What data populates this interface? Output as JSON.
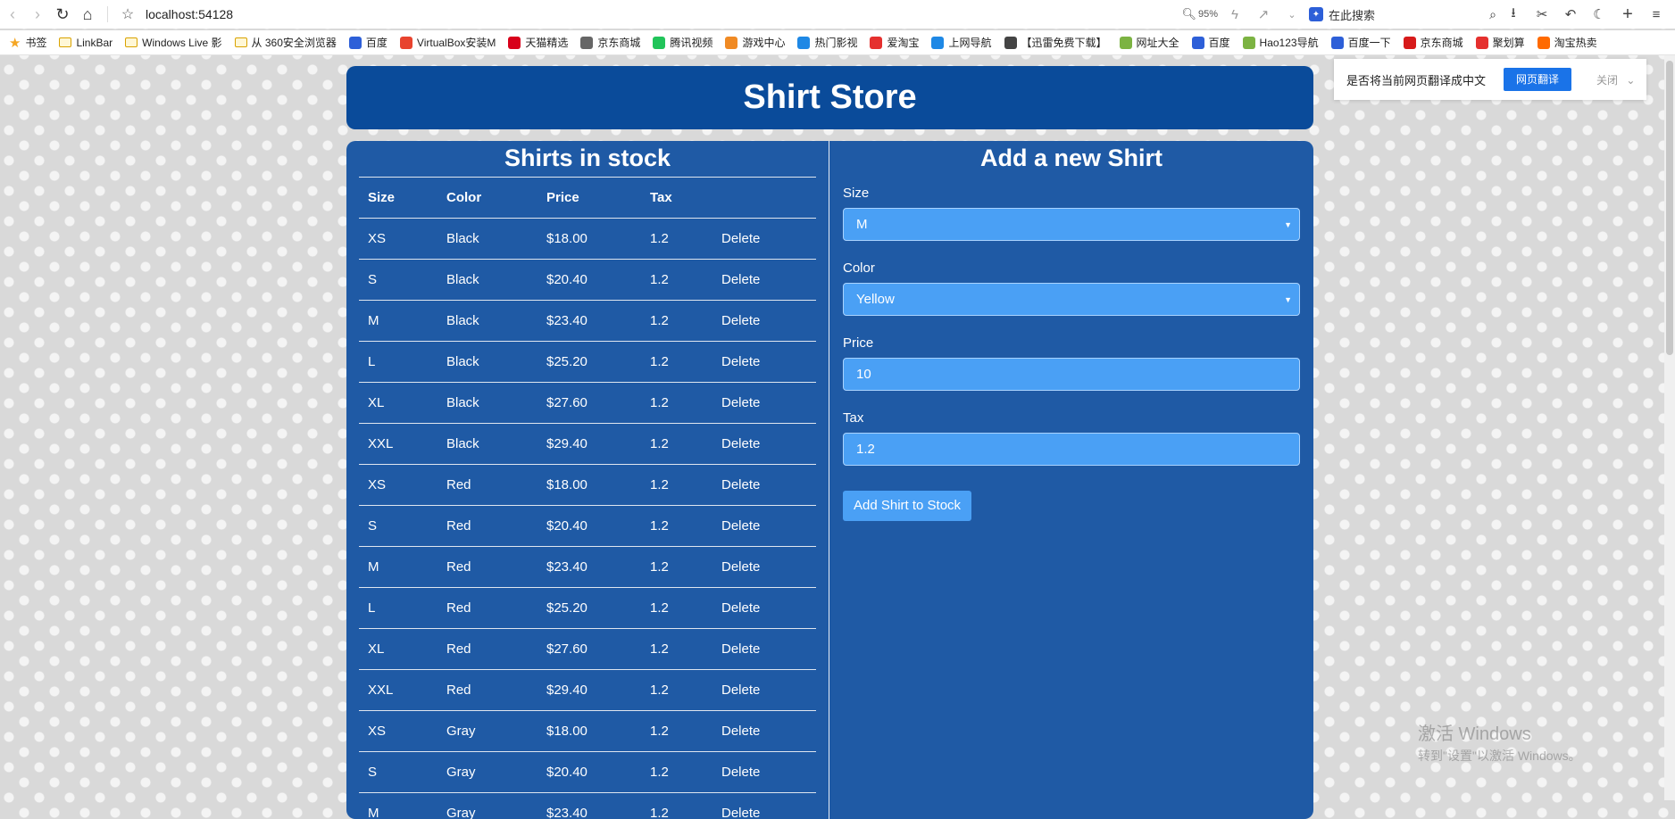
{
  "browser": {
    "url": "localhost:54128",
    "zoom": "95%",
    "search_placeholder": "在此搜索",
    "bookmarks": [
      {
        "label": "书签",
        "icon": "star-icon",
        "color": "#f5a623"
      },
      {
        "label": "LinkBar",
        "icon": "folder-icon",
        "color": "#d9a200"
      },
      {
        "label": "Windows Live 影",
        "icon": "folder-icon",
        "color": "#d9a200"
      },
      {
        "label": "从 360安全浏览器",
        "icon": "folder-icon",
        "color": "#d9a200"
      },
      {
        "label": "百度",
        "icon": "baidu-icon",
        "color": "#2d5fd8"
      },
      {
        "label": "VirtualBox安装M",
        "icon": "c-icon",
        "color": "#e8432e"
      },
      {
        "label": "天猫精选",
        "icon": "tmall-icon",
        "color": "#d8001a"
      },
      {
        "label": "京东商城",
        "icon": "globe-icon",
        "color": "#666666"
      },
      {
        "label": "腾讯视频",
        "icon": "video-icon",
        "color": "#21c45a"
      },
      {
        "label": "游戏中心",
        "icon": "game-icon",
        "color": "#f08a24"
      },
      {
        "label": "热门影视",
        "icon": "film-icon",
        "color": "#1e88e5"
      },
      {
        "label": "爱淘宝",
        "icon": "taobao-icon",
        "color": "#e5302e"
      },
      {
        "label": "上网导航",
        "icon": "nav-icon",
        "color": "#1e88e5"
      },
      {
        "label": "【迅雷免费下载】",
        "icon": "xunlei-icon",
        "color": "#444444"
      },
      {
        "label": "网址大全",
        "icon": "hao-icon",
        "color": "#7cb342"
      },
      {
        "label": "百度",
        "icon": "baidu-icon",
        "color": "#2d5fd8"
      },
      {
        "label": "Hao123导航",
        "icon": "hao-icon",
        "color": "#7cb342"
      },
      {
        "label": "百度一下",
        "icon": "baidu-icon",
        "color": "#2d5fd8"
      },
      {
        "label": "京东商城",
        "icon": "jd-icon",
        "color": "#d71a1a"
      },
      {
        "label": "聚划算",
        "icon": "juhuasuan-icon",
        "color": "#e5302e"
      },
      {
        "label": "淘宝热卖",
        "icon": "taobao-icon",
        "color": "#ff6a00"
      }
    ]
  },
  "page": {
    "title": "Shirt Store",
    "stock_title": "Shirts in stock",
    "columns": [
      "Size",
      "Color",
      "Price",
      "Tax"
    ],
    "delete_label": "Delete",
    "rows": [
      {
        "size": "XS",
        "color": "Black",
        "price": "$18.00",
        "tax": "1.2"
      },
      {
        "size": "S",
        "color": "Black",
        "price": "$20.40",
        "tax": "1.2"
      },
      {
        "size": "M",
        "color": "Black",
        "price": "$23.40",
        "tax": "1.2"
      },
      {
        "size": "L",
        "color": "Black",
        "price": "$25.20",
        "tax": "1.2"
      },
      {
        "size": "XL",
        "color": "Black",
        "price": "$27.60",
        "tax": "1.2"
      },
      {
        "size": "XXL",
        "color": "Black",
        "price": "$29.40",
        "tax": "1.2"
      },
      {
        "size": "XS",
        "color": "Red",
        "price": "$18.00",
        "tax": "1.2"
      },
      {
        "size": "S",
        "color": "Red",
        "price": "$20.40",
        "tax": "1.2"
      },
      {
        "size": "M",
        "color": "Red",
        "price": "$23.40",
        "tax": "1.2"
      },
      {
        "size": "L",
        "color": "Red",
        "price": "$25.20",
        "tax": "1.2"
      },
      {
        "size": "XL",
        "color": "Red",
        "price": "$27.60",
        "tax": "1.2"
      },
      {
        "size": "XXL",
        "color": "Red",
        "price": "$29.40",
        "tax": "1.2"
      },
      {
        "size": "XS",
        "color": "Gray",
        "price": "$18.00",
        "tax": "1.2"
      },
      {
        "size": "S",
        "color": "Gray",
        "price": "$20.40",
        "tax": "1.2"
      },
      {
        "size": "M",
        "color": "Gray",
        "price": "$23.40",
        "tax": "1.2"
      }
    ],
    "form": {
      "title": "Add a new Shirt",
      "size_label": "Size",
      "size_value": "M",
      "color_label": "Color",
      "color_value": "Yellow",
      "price_label": "Price",
      "price_value": "10",
      "tax_label": "Tax",
      "tax_value": "1.2",
      "submit_label": "Add Shirt to Stock"
    }
  },
  "translate_bar": {
    "prompt": "是否将当前网页翻译成中文",
    "translate_button": "网页翻译",
    "close_label": "关闭"
  },
  "watermark": {
    "line1": "激活 Windows",
    "line2": "转到\"设置\"以激活 Windows。"
  },
  "colors": {
    "header_bg": "#0a4b9a",
    "panel_bg": "#1f5aa5",
    "input_bg": "#4aa0f5",
    "translate_btn": "#1a73e8"
  }
}
